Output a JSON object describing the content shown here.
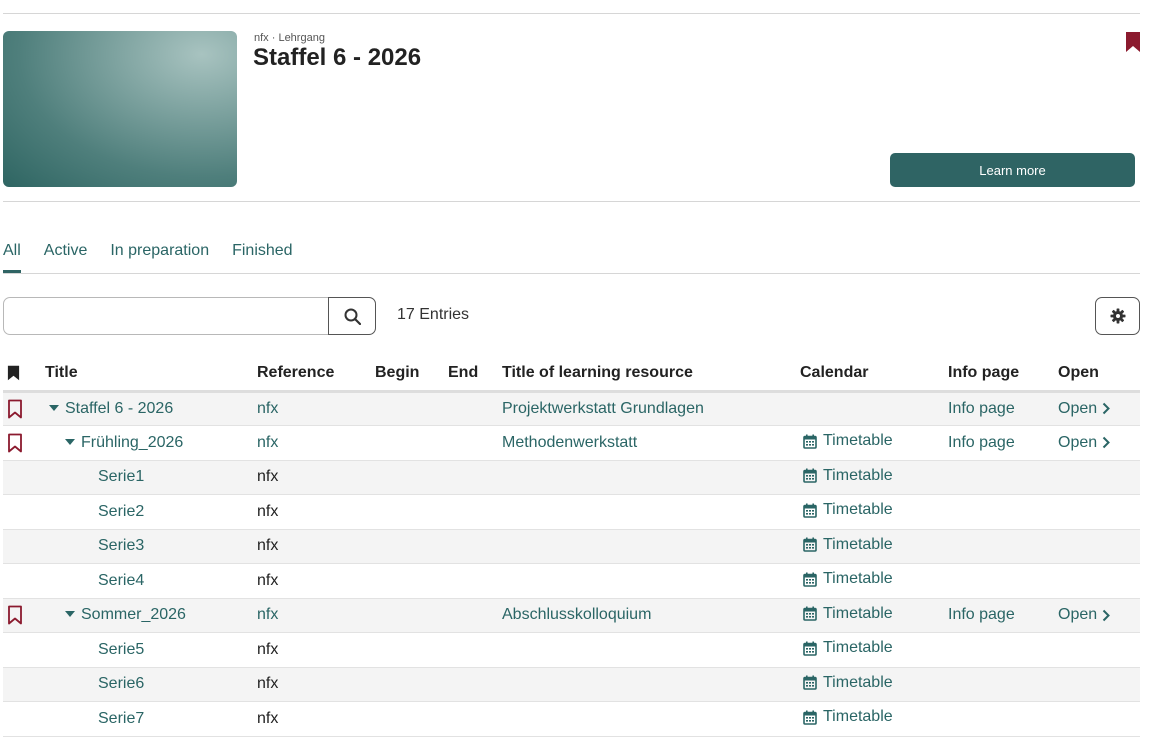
{
  "header": {
    "eyebrow": "nfx · Lehrgang",
    "title": "Staffel 6 - 2026",
    "learn_more": "Learn more"
  },
  "tabs": [
    {
      "label": "All",
      "active": true
    },
    {
      "label": "Active"
    },
    {
      "label": "In preparation"
    },
    {
      "label": "Finished"
    }
  ],
  "search": {
    "value": "",
    "placeholder": "",
    "entries": "17 Entries"
  },
  "table": {
    "columns": [
      "Title",
      "Reference",
      "Begin",
      "End",
      "Title of learning resource",
      "Calendar",
      "Info page",
      "Open"
    ],
    "rows": [
      {
        "title": "Staffel 6 - 2026",
        "ref": "nfx",
        "resource": "Projektwerkstatt Grundlagen",
        "calendar": "",
        "info": "Info page",
        "open": "Open"
      },
      {
        "title": "Frühling_2026",
        "ref": "nfx",
        "resource": "Methodenwerkstatt",
        "calendar": "Timetable",
        "info": "Info page",
        "open": "Open"
      },
      {
        "title": "Serie1",
        "ref": "nfx",
        "resource": "",
        "calendar": "Timetable",
        "info": "",
        "open": ""
      },
      {
        "title": "Serie2",
        "ref": "nfx",
        "resource": "",
        "calendar": "Timetable",
        "info": "",
        "open": ""
      },
      {
        "title": "Serie3",
        "ref": "nfx",
        "resource": "",
        "calendar": "Timetable",
        "info": "",
        "open": ""
      },
      {
        "title": "Serie4",
        "ref": "nfx",
        "resource": "",
        "calendar": "Timetable",
        "info": "",
        "open": ""
      },
      {
        "title": "Sommer_2026",
        "ref": "nfx",
        "resource": "Abschlusskolloquium",
        "calendar": "Timetable",
        "info": "Info page",
        "open": "Open"
      },
      {
        "title": "Serie5",
        "ref": "nfx",
        "resource": "",
        "calendar": "Timetable",
        "info": "",
        "open": ""
      },
      {
        "title": "Serie6",
        "ref": "nfx",
        "resource": "",
        "calendar": "Timetable",
        "info": "",
        "open": ""
      },
      {
        "title": "Serie7",
        "ref": "nfx",
        "resource": "",
        "calendar": "Timetable",
        "info": "",
        "open": ""
      }
    ]
  },
  "colors": {
    "accent": "#2f6464",
    "bookmark": "#8b1a2e",
    "link": "#2a6565"
  },
  "icons": {
    "bookmark": "bookmark-icon",
    "search": "search-icon",
    "settings": "gear-icon",
    "calendar": "calendar-icon",
    "caret": "caret-down-icon",
    "chevron": "chevron-right-icon"
  }
}
